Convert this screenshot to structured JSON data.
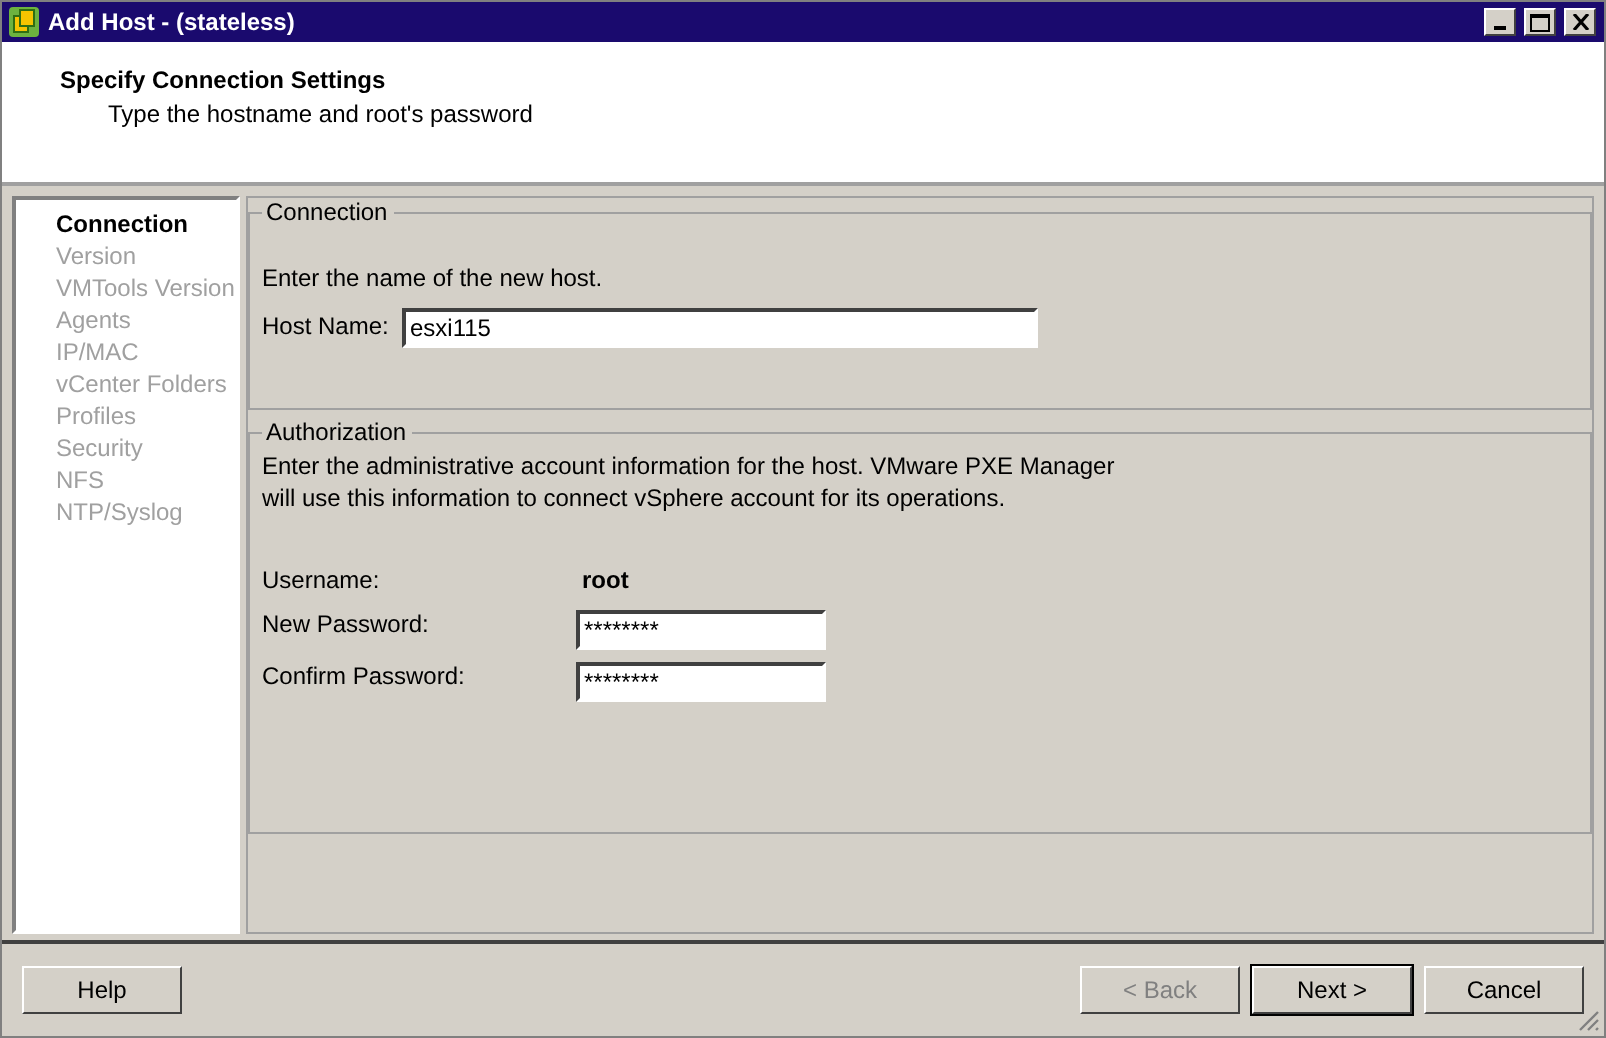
{
  "window": {
    "title": "Add Host - (stateless)"
  },
  "header": {
    "title": "Specify Connection Settings",
    "subtitle": "Type the hostname and root's password"
  },
  "steps": [
    {
      "label": "Connection",
      "selected": true
    },
    {
      "label": "Version",
      "selected": false
    },
    {
      "label": "VMTools Version",
      "selected": false
    },
    {
      "label": "Agents",
      "selected": false
    },
    {
      "label": "IP/MAC",
      "selected": false
    },
    {
      "label": "vCenter Folders",
      "selected": false
    },
    {
      "label": "Profiles",
      "selected": false
    },
    {
      "label": "Security",
      "selected": false
    },
    {
      "label": "NFS",
      "selected": false
    },
    {
      "label": "NTP/Syslog",
      "selected": false
    }
  ],
  "connection": {
    "legend": "Connection",
    "text": "Enter the name of the new host.",
    "host_label": "Host Name:",
    "host_value": "esxi115"
  },
  "authorization": {
    "legend": "Authorization",
    "text_lines": [
      "Enter the administrative account information for the host. VMware PXE Manager",
      "will use this information to connect vSphere  account for its operations."
    ],
    "username_label": "Username:",
    "username": "root",
    "new_password_label": "New Password:",
    "new_password": "********",
    "confirm_password_label": "Confirm Password:",
    "confirm_password": "********"
  },
  "buttons": [
    {
      "label": "Help",
      "disabled": false,
      "default": false
    },
    {
      "label": "< Back",
      "disabled": true,
      "default": false
    },
    {
      "label": "Next >",
      "disabled": false,
      "default": true
    },
    {
      "label": "Cancel",
      "disabled": false,
      "default": false
    }
  ]
}
